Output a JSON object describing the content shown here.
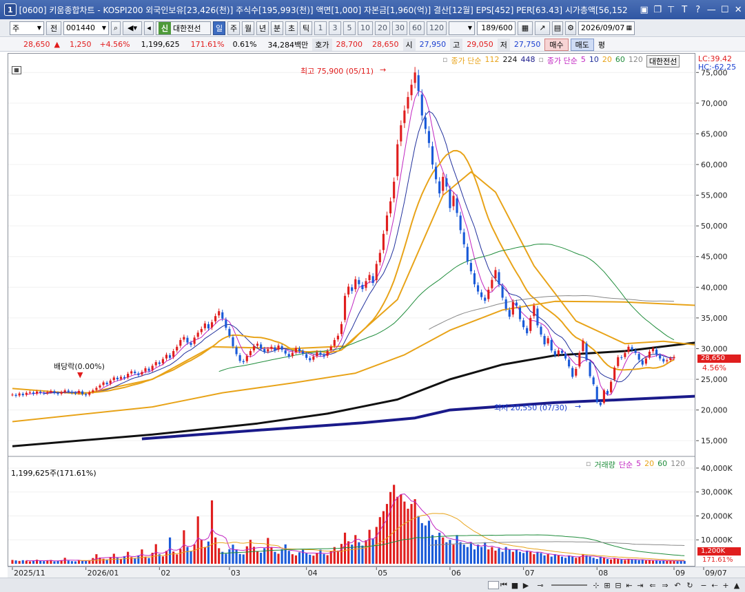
{
  "window": {
    "number": "1",
    "title": "[0600] 키움종합차트 - KOSPI200 외국인보유[23,426(천)] 주식수[195,993(천)] 액면[1,000] 자본금[1,960(억)] 결산[12월] EPS[452] PER[63.43] 시가총액[56,152"
  },
  "toolbar": {
    "period_type": "주",
    "market": "전",
    "stock_code": "001440",
    "stock_name": "대한전선",
    "sin_badge": "신",
    "periods": [
      "일",
      "주",
      "월",
      "년",
      "분",
      "초",
      "틱"
    ],
    "active_period": "일",
    "intervals": [
      "1",
      "3",
      "5",
      "10",
      "20",
      "30",
      "60",
      "120"
    ],
    "count": "189",
    "count_total": "/600",
    "date": "2026/09/07"
  },
  "quote": {
    "price": "28,650",
    "arrow": "▲",
    "change": "1,250",
    "change_pct": "+4.56%",
    "volume": "1,199,625",
    "volume_ratio": "171.61%",
    "turnover": "0.61%",
    "amount": "34,284백만",
    "bid_label": "호가",
    "bid1": "28,700",
    "bid2": "28,650",
    "open_label": "시",
    "open": "27,950",
    "high_label": "고",
    "high": "29,050",
    "low_label": "저",
    "low": "27,750",
    "buy_label": "매수",
    "sell_label": "매도",
    "eval_label": "평"
  },
  "price_legend": {
    "close_simple_label": "종가 단순",
    "long_periods": [
      "112",
      "224",
      "448"
    ],
    "long_colors": [
      "#e8a318",
      "#111111",
      "#1a1a8a"
    ],
    "short_label": "종가 단순",
    "short_periods": [
      "5",
      "10",
      "20",
      "60",
      "120"
    ],
    "short_colors": [
      "#c023c0",
      "#1f2f9c",
      "#e8a318",
      "#1e8c3a",
      "#888888"
    ],
    "stock_badge": "대한전선"
  },
  "indicators": {
    "lc": "LC:39.42",
    "hc": "HC:-62.25"
  },
  "annotations": {
    "high_label": "최고 75,900 (05/11)",
    "low_label": "최저 20,550 (07/30)",
    "dividend_label": "배당락(0.00%)"
  },
  "current_price_tag": {
    "price": "28,650",
    "pct": "4.56%"
  },
  "volume_pane": {
    "header": "1,199,625주(171.61%)",
    "legend_label": "거래량",
    "legend_ma_label": "단순",
    "legend_periods": [
      "5",
      "20",
      "60",
      "120"
    ],
    "legend_colors": [
      "#c023c0",
      "#e8a318",
      "#1e8c3a",
      "#888888"
    ],
    "current_tag": "1,200K",
    "current_pct": "171.61%"
  },
  "y_axis_labels": [
    "75,000",
    "70,000",
    "65,000",
    "60,000",
    "55,000",
    "50,000",
    "45,000",
    "40,000",
    "35,000",
    "30,000",
    "25,000",
    "20,000",
    "15,000"
  ],
  "vol_axis_labels": [
    "40,000K",
    "30,000K",
    "20,000K",
    "10,000K"
  ],
  "x_axis_labels": [
    "2025/11",
    "2026/01",
    "02",
    "03",
    "04",
    "05",
    "06",
    "07",
    "08",
    "09",
    "09/07"
  ],
  "chart_data": {
    "type": "candlestick",
    "ylim": [
      13000,
      77500
    ],
    "closes": [
      22500,
      22300,
      22700,
      22400,
      22800,
      22900,
      22600,
      23000,
      22800,
      22700,
      22900,
      23100,
      22800,
      22600,
      22900,
      23200,
      23000,
      22800,
      22700,
      23100,
      22600,
      22400,
      22900,
      23200,
      23600,
      24000,
      24500,
      24200,
      24800,
      25300,
      25000,
      25400,
      25200,
      25900,
      26300,
      26000,
      25700,
      26200,
      26800,
      26400,
      27200,
      27800,
      27500,
      28300,
      29000,
      28500,
      29600,
      30300,
      31400,
      31900,
      31000,
      30600,
      31800,
      32600,
      33200,
      34100,
      33300,
      34300,
      35300,
      36100,
      34900,
      33400,
      32100,
      30400,
      29100,
      28000,
      27800,
      28800,
      29600,
      30400,
      30800,
      30000,
      29500,
      29900,
      30300,
      29700,
      30500,
      29800,
      29200,
      28700,
      29300,
      30100,
      29600,
      29200,
      28500,
      28100,
      28700,
      29400,
      29000,
      28700,
      29600,
      30300,
      31400,
      32100,
      34000,
      38600,
      40100,
      39400,
      41300,
      40500,
      39700,
      41000,
      42000,
      40700,
      43800,
      45600,
      48700,
      51700,
      54000,
      57200,
      63300,
      66400,
      68800,
      71000,
      73000,
      75000,
      72000,
      68000,
      65800,
      63500,
      60000,
      57600,
      55300,
      58000,
      56400,
      52900,
      54900,
      52100,
      49300,
      47000,
      44200,
      42600,
      40500,
      39300,
      38400,
      37800,
      39600,
      41200,
      42800,
      40500,
      38300,
      36500,
      35200,
      37600,
      37000,
      34800,
      33500,
      32500,
      35000,
      37000,
      33800,
      32300,
      30700,
      31700,
      29700,
      28900,
      29700,
      29300,
      28400,
      27100,
      25400,
      26700,
      29300,
      31300,
      28200,
      25500,
      24200,
      21300,
      20800,
      23200,
      22600,
      24600,
      26900,
      28600,
      28500,
      29300,
      30300,
      29800,
      29300,
      28200,
      27400,
      28400,
      29500,
      30000,
      29000,
      28400,
      27900,
      28100,
      28400,
      28650
    ],
    "volumes": [
      1.6,
      1.4,
      1.2,
      1.5,
      1.3,
      1.0,
      1.4,
      1.7,
      1.2,
      1.1,
      1.3,
      1.6,
      1.0,
      1.2,
      1.5,
      2.5,
      1.3,
      1.1,
      1.0,
      1.6,
      1.3,
      1.2,
      1.5,
      2.4,
      4.0,
      2.6,
      2.1,
      1.8,
      2.8,
      4.2,
      2.5,
      1.9,
      3.2,
      5.0,
      2.8,
      2.2,
      3.5,
      6.0,
      3.0,
      2.4,
      4.6,
      8.2,
      4.0,
      3.1,
      5.4,
      11.0,
      5.1,
      3.9,
      6.2,
      14.0,
      7.0,
      5.2,
      8.1,
      19.8,
      10.0,
      7.0,
      9.3,
      26.5,
      11.0,
      6.5,
      5.0,
      4.2,
      6.1,
      8.0,
      6.0,
      4.1,
      3.9,
      7.3,
      10.0,
      7.1,
      5.2,
      4.6,
      6.5,
      10.8,
      7.0,
      5.0,
      4.2,
      6.1,
      8.1,
      5.4,
      4.0,
      3.5,
      4.8,
      6.0,
      4.4,
      3.8,
      3.4,
      4.6,
      5.9,
      4.1,
      3.6,
      5.2,
      7.0,
      5.5,
      8.3,
      13.0,
      9.4,
      8.0,
      12.0,
      9.0,
      7.6,
      9.8,
      14.2,
      10.6,
      15.4,
      19.5,
      22.0,
      25.0,
      30.0,
      33.0,
      28.0,
      29.0,
      26.0,
      23.0,
      25.0,
      27.0,
      20.0,
      17.0,
      16.0,
      18.0,
      12.0,
      10.0,
      13.0,
      11.0,
      9.0,
      10.0,
      8.0,
      12.0,
      9.0,
      8.0,
      7.0,
      9.0,
      6.0,
      8.0,
      7.0,
      9.0,
      6.0,
      7.0,
      5.5,
      6.5,
      5.0,
      7.0,
      6.0,
      5.0,
      6.0,
      5.0,
      4.5,
      5.5,
      5.0,
      4.0,
      5.0,
      4.5,
      3.5,
      4.0,
      3.0,
      4.0,
      3.5,
      3.0,
      2.5,
      3.5,
      3.0,
      2.5,
      3.0,
      4.0,
      3.5,
      3.0,
      2.5,
      2.0,
      3.0,
      2.5,
      2.0,
      1.8,
      2.2,
      2.0,
      1.8,
      1.6,
      2.0,
      1.8,
      1.7,
      1.5,
      1.6,
      1.4,
      1.5,
      1.3,
      1.4,
      1.2,
      1.3,
      1.2,
      1.3,
      1.2,
      1.1,
      1.2,
      1.2
    ],
    "ma": {
      "ma112": [
        [
          0,
          23500
        ],
        [
          20,
          22600
        ],
        [
          40,
          25000
        ],
        [
          57,
          30300
        ],
        [
          80,
          30000
        ],
        [
          95,
          30400
        ],
        [
          110,
          38000
        ],
        [
          123,
          55000
        ],
        [
          131,
          58800
        ],
        [
          138,
          55500
        ],
        [
          149,
          43500
        ],
        [
          161,
          34500
        ],
        [
          175,
          30800
        ],
        [
          186,
          31200
        ],
        [
          197,
          30500
        ],
        [
          210,
          30400
        ]
      ],
      "ma224": [
        [
          0,
          18100
        ],
        [
          40,
          20500
        ],
        [
          60,
          22800
        ],
        [
          80,
          24400
        ],
        [
          98,
          26000
        ],
        [
          112,
          29000
        ],
        [
          125,
          33000
        ],
        [
          140,
          36300
        ],
        [
          155,
          37700
        ],
        [
          175,
          37600
        ],
        [
          197,
          37000
        ]
      ],
      "ma448": [
        [
          0,
          14100
        ],
        [
          40,
          16000
        ],
        [
          70,
          17800
        ],
        [
          90,
          19400
        ],
        [
          110,
          21700
        ],
        [
          125,
          25000
        ],
        [
          140,
          27400
        ],
        [
          155,
          28900
        ],
        [
          175,
          29600
        ],
        [
          197,
          31100
        ]
      ],
      "ma_long_b": [
        [
          37,
          15300
        ],
        [
          70,
          16700
        ],
        [
          100,
          17900
        ],
        [
          115,
          18700
        ],
        [
          125,
          20000
        ],
        [
          140,
          20600
        ],
        [
          155,
          21200
        ],
        [
          175,
          21700
        ],
        [
          197,
          22300
        ]
      ]
    },
    "dates": [
      "2025/11",
      "2026/01",
      "02",
      "03",
      "04",
      "05",
      "06",
      "07",
      "08",
      "09"
    ]
  }
}
